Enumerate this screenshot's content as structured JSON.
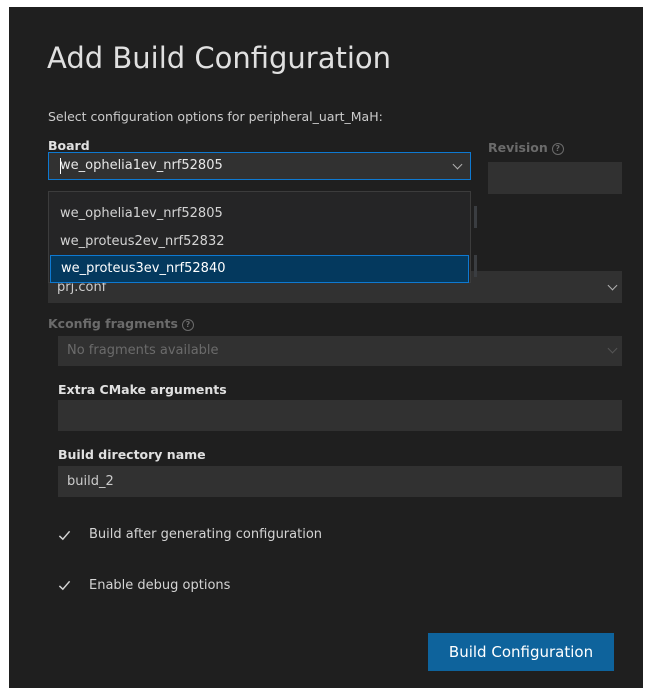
{
  "dialog": {
    "title": "Add Build Configuration",
    "subtitle": "Select configuration options for peripheral_uart_MaH:"
  },
  "board": {
    "label": "Board",
    "value": "we_ophelia1ev_nrf52805",
    "options": [
      "we_ophelia1ev_nrf52805",
      "we_proteus2ev_nrf52832",
      "we_proteus3ev_nrf52840"
    ],
    "highlighted_option": "we_proteus3ev_nrf52840"
  },
  "revision": {
    "label": "Revision",
    "value": ""
  },
  "config_file": {
    "value": "prj.conf"
  },
  "kconfig": {
    "label": "Kconfig fragments",
    "placeholder": "No fragments available"
  },
  "cmake": {
    "label": "Extra CMake arguments",
    "value": ""
  },
  "build_dir": {
    "label": "Build directory name",
    "value": "build_2"
  },
  "checkboxes": {
    "build_after": {
      "label": "Build after generating configuration",
      "checked": true
    },
    "debug": {
      "label": "Enable debug options",
      "checked": true
    }
  },
  "submit": {
    "label": "Build Configuration"
  },
  "colors": {
    "accent": "#0e639c",
    "focus": "#0e79d1",
    "background": "#1f1f1f",
    "selection": "#04395e"
  },
  "icons": [
    "help-circle-icon",
    "chevron-down-icon",
    "checkmark-icon"
  ]
}
